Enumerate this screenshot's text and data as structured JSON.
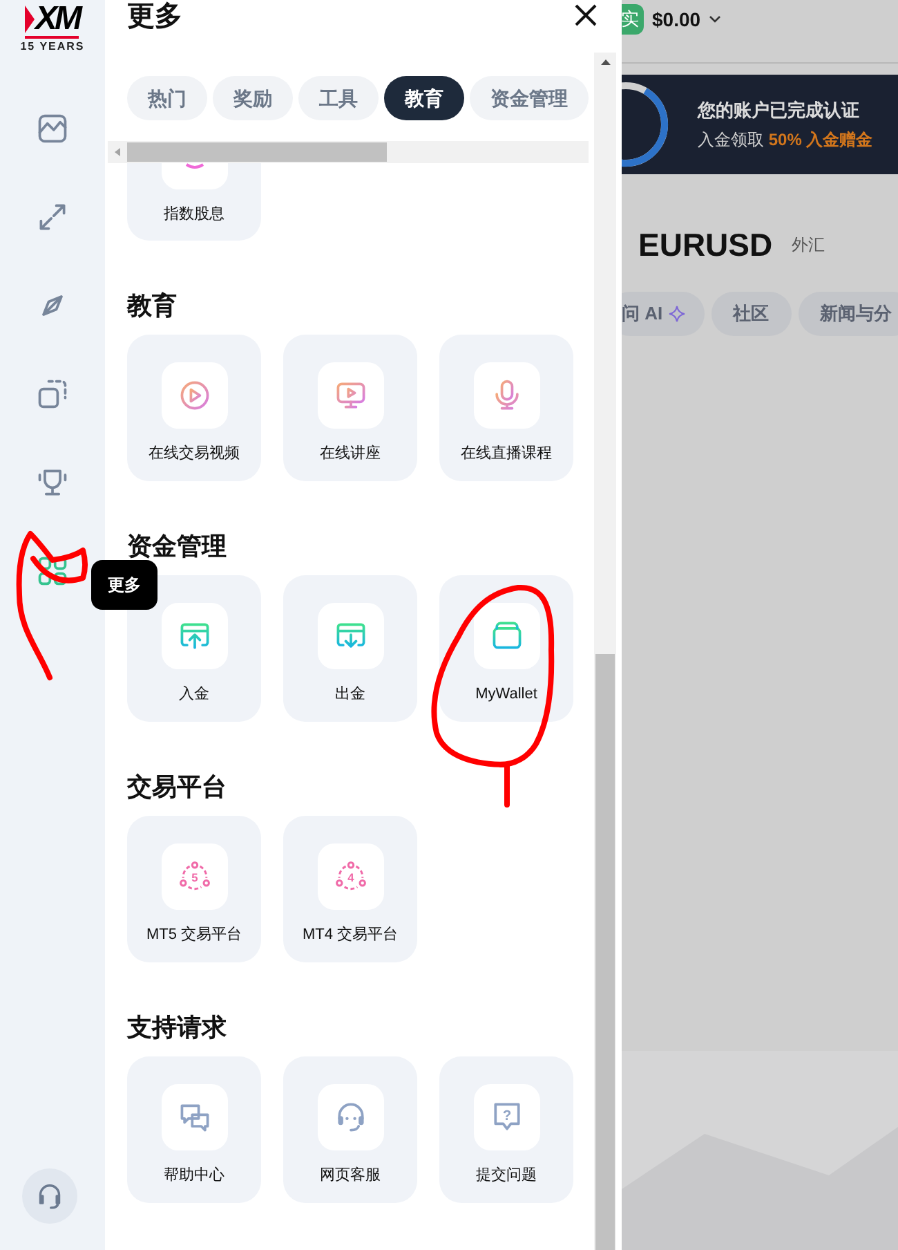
{
  "sidebar": {
    "logo": "XM",
    "logo_subtitle": "15 YEARS",
    "items": [
      {
        "kind": "chart",
        "selected": false
      },
      {
        "kind": "swap",
        "selected": false
      },
      {
        "kind": "compass",
        "selected": false
      },
      {
        "kind": "copy",
        "selected": false
      },
      {
        "kind": "trophy",
        "selected": false
      },
      {
        "kind": "grid",
        "selected": true
      }
    ],
    "tooltip": "更多"
  },
  "panel": {
    "title": "更多",
    "tabs": [
      {
        "label": "热门",
        "selected": false
      },
      {
        "label": "奖励",
        "selected": false
      },
      {
        "label": "工具",
        "selected": false
      },
      {
        "label": "教育",
        "selected": true
      },
      {
        "label": "资金管理",
        "selected": false
      }
    ],
    "partial_item": {
      "label": "指数股息"
    },
    "sections": [
      {
        "title": "教育",
        "items": [
          {
            "label": "在线交易视频",
            "kind": "play"
          },
          {
            "label": "在线讲座",
            "kind": "monitor"
          },
          {
            "label": "在线直播课程",
            "kind": "mic"
          }
        ]
      },
      {
        "title": "资金管理",
        "items": [
          {
            "label": "入金",
            "kind": "deposit"
          },
          {
            "label": "出金",
            "kind": "withdraw"
          },
          {
            "label": "MyWallet",
            "kind": "wallet"
          }
        ]
      },
      {
        "title": "交易平台",
        "items": [
          {
            "label": "MT5 交易平台",
            "kind": "platform",
            "icon_text": "5"
          },
          {
            "label": "MT4 交易平台",
            "kind": "platform",
            "icon_text": "4"
          }
        ]
      },
      {
        "title": "支持请求",
        "items": [
          {
            "label": "帮助中心",
            "kind": "chat"
          },
          {
            "label": "网页客服",
            "kind": "headset"
          },
          {
            "label": "提交问题",
            "kind": "question",
            "icon_text": "?"
          }
        ]
      }
    ]
  },
  "background": {
    "account_badge": "实",
    "balance": "$0.00",
    "banner": {
      "title": "您的账户已完成认证",
      "subtitle": "入金领取",
      "highlight": "50% 入金赠金"
    },
    "symbol": "EURUSD",
    "symbol_type": "外汇",
    "pills": [
      {
        "label": "问 AI",
        "kind": "ai"
      },
      {
        "label": "社区",
        "kind": "plain"
      },
      {
        "label": "新闻与分",
        "kind": "plain"
      }
    ]
  }
}
